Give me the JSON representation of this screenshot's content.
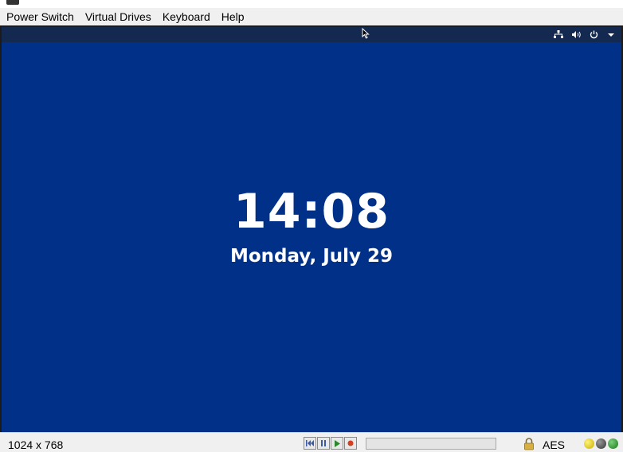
{
  "menu": {
    "items": [
      "Power Switch",
      "Virtual Drives",
      "Keyboard",
      "Help"
    ]
  },
  "remote_screen": {
    "tray_icons": [
      "network-icon",
      "volume-icon",
      "power-icon",
      "dropdown-arrow-icon"
    ],
    "lock_screen": {
      "time": "14:08",
      "date": "Monday, July 29"
    },
    "background_color": "#003087"
  },
  "statusbar": {
    "resolution": "1024 x 768",
    "media_controls": [
      "rewind-icon",
      "pause-icon",
      "play-icon",
      "record-icon"
    ],
    "encryption_label": "AES",
    "indicator_colors": [
      "#e6d200",
      "#555555",
      "#2a9a2a"
    ]
  }
}
